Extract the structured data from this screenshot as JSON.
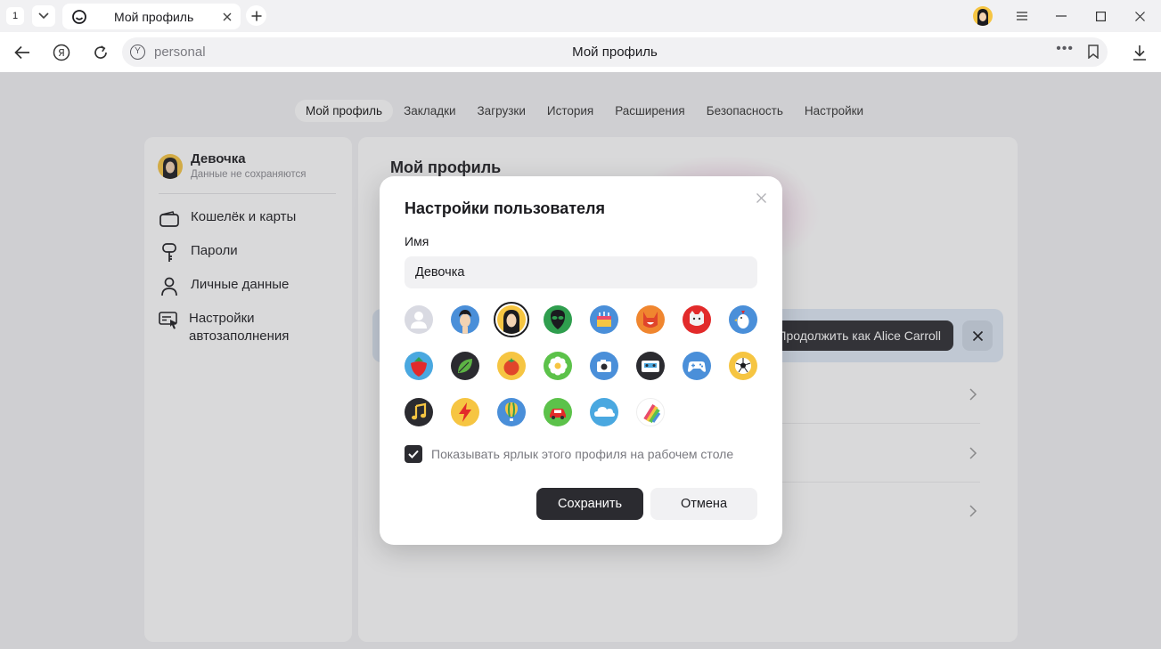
{
  "tabstrip": {
    "tab_count": "1",
    "active_tab_title": "Мой профиль"
  },
  "navbar": {
    "url": "personal",
    "page_title": "Мой профиль"
  },
  "page_nav": {
    "items": [
      "Мой профиль",
      "Закладки",
      "Загрузки",
      "История",
      "Расширения",
      "Безопасность",
      "Настройки"
    ],
    "active_index": 0
  },
  "sidebar": {
    "profile_name": "Девочка",
    "profile_subtitle": "Данные не сохраняются",
    "items": [
      {
        "label": "Кошелёк и карты",
        "icon": "wallet-icon"
      },
      {
        "label": "Пароли",
        "icon": "key-icon"
      },
      {
        "label": "Личные данные",
        "icon": "person-icon"
      },
      {
        "label": "Настройки автозаполнения",
        "icon": "autofill-icon"
      }
    ]
  },
  "main": {
    "title": "Мой профиль",
    "continue_label": "Продолжить как Alice Carroll"
  },
  "modal": {
    "title": "Настройки пользователя",
    "name_label": "Имя",
    "name_value": "Девочка",
    "avatars": [
      "default-user",
      "boy",
      "girl",
      "alien",
      "cake",
      "fox",
      "cat",
      "chicken",
      "strawberry",
      "leaf",
      "tomato",
      "flower",
      "camera",
      "cassette",
      "gamepad",
      "soccer-ball",
      "music-note",
      "lightning",
      "hot-air-balloon",
      "car",
      "cloud",
      "multicolor"
    ],
    "selected_avatar": "girl",
    "checkbox_checked": true,
    "checkbox_label": "Показывать ярлык этого профиля на рабочем столе",
    "save_label": "Сохранить",
    "cancel_label": "Отмена"
  },
  "colors": {
    "primary_button": "#2b2b30",
    "accent_yellow": "#f6c542",
    "banner_bg": "#dfe9f6"
  }
}
